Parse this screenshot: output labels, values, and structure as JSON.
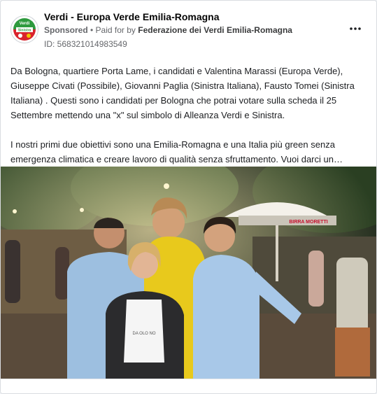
{
  "post": {
    "page_name": "Verdi - Europa Verde Emilia-Romagna",
    "sponsored_label": "Sponsored",
    "separator": " • ",
    "paid_for_prefix": "Paid for by ",
    "payer": "Federazione dei Verdi Emilia-Romagna",
    "ad_id": "ID: 568321014983549",
    "more_icon": "more-horizontal-icon",
    "body": {
      "paragraph_1": "Da Bologna, quartiere Porta Lame, i candidati e Valentina Marassi (Europa Verde), Giuseppe Civati (Possibile), Giovanni Paglia (Sinistra Italiana), Fausto Tomei (Sinistra Italiana) . Questi sono i candidati per Bologna che potrai votare sulla scheda il 25 Settembre mettendo una \"x\" sul simbolo di Alleanza Verdi e Sinistra.",
      "paragraph_2": "I nostri primi due obiettivi sono una Emilia-Romagna e una Italia più green senza emergenza climatica e creare lavoro di qualità senza sfruttamento. Vuoi darci un…"
    }
  },
  "photo": {
    "umbrella_text": "BIRRA MORETTI",
    "shirt_text": "DA OLO NO"
  },
  "colors": {
    "accent_green": "#2e9a3e",
    "accent_red": "#d9232d",
    "meta_gray": "#65676b"
  }
}
